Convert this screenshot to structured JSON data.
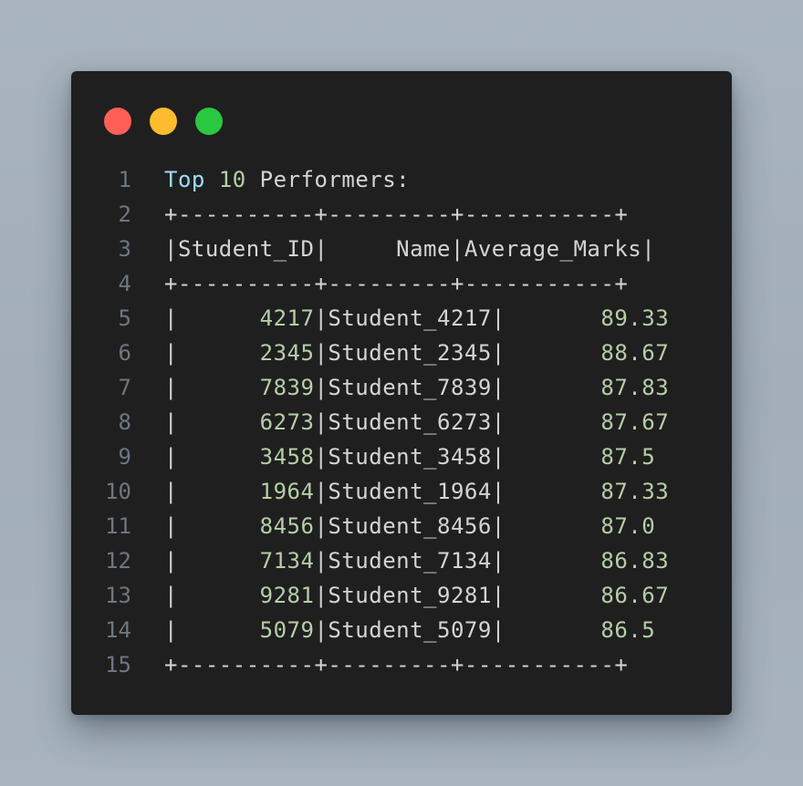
{
  "window_controls": {
    "close_color": "#ff5f57",
    "minimize_color": "#febc2e",
    "maximize_color": "#28c840"
  },
  "theme": {
    "background": "#1f1f1f",
    "text": "#d4d4d4",
    "line_number": "#6e7681",
    "keyword": "#9cdcfe",
    "number": "#b5cea8"
  },
  "lines": [
    {
      "n": "1",
      "segments": [
        {
          "t": "Top",
          "c": "kw"
        },
        {
          "t": " ",
          "c": "plain"
        },
        {
          "t": "10",
          "c": "num"
        },
        {
          "t": " Performers:",
          "c": "plain"
        }
      ]
    },
    {
      "n": "2",
      "segments": [
        {
          "t": "+----------+---------+-----------+",
          "c": "plain"
        }
      ]
    },
    {
      "n": "3",
      "segments": [
        {
          "t": "|Student_ID|     Name|Average_Marks|",
          "c": "plain"
        }
      ]
    },
    {
      "n": "4",
      "segments": [
        {
          "t": "+----------+---------+-----------+",
          "c": "plain"
        }
      ]
    },
    {
      "n": "5",
      "segments": [
        {
          "t": "|      ",
          "c": "plain"
        },
        {
          "t": "4217",
          "c": "num"
        },
        {
          "t": "|Student_4217|       ",
          "c": "plain"
        },
        {
          "t": "89.33",
          "c": "num"
        }
      ]
    },
    {
      "n": "6",
      "segments": [
        {
          "t": "|      ",
          "c": "plain"
        },
        {
          "t": "2345",
          "c": "num"
        },
        {
          "t": "|Student_2345|       ",
          "c": "plain"
        },
        {
          "t": "88.67",
          "c": "num"
        }
      ]
    },
    {
      "n": "7",
      "segments": [
        {
          "t": "|      ",
          "c": "plain"
        },
        {
          "t": "7839",
          "c": "num"
        },
        {
          "t": "|Student_7839|       ",
          "c": "plain"
        },
        {
          "t": "87.83",
          "c": "num"
        }
      ]
    },
    {
      "n": "8",
      "segments": [
        {
          "t": "|      ",
          "c": "plain"
        },
        {
          "t": "6273",
          "c": "num"
        },
        {
          "t": "|Student_6273|       ",
          "c": "plain"
        },
        {
          "t": "87.67",
          "c": "num"
        }
      ]
    },
    {
      "n": "9",
      "segments": [
        {
          "t": "|      ",
          "c": "plain"
        },
        {
          "t": "3458",
          "c": "num"
        },
        {
          "t": "|Student_3458|       ",
          "c": "plain"
        },
        {
          "t": "87.5",
          "c": "num"
        }
      ]
    },
    {
      "n": "10",
      "segments": [
        {
          "t": "|      ",
          "c": "plain"
        },
        {
          "t": "1964",
          "c": "num"
        },
        {
          "t": "|Student_1964|       ",
          "c": "plain"
        },
        {
          "t": "87.33",
          "c": "num"
        }
      ]
    },
    {
      "n": "11",
      "segments": [
        {
          "t": "|      ",
          "c": "plain"
        },
        {
          "t": "8456",
          "c": "num"
        },
        {
          "t": "|Student_8456|       ",
          "c": "plain"
        },
        {
          "t": "87.0",
          "c": "num"
        }
      ]
    },
    {
      "n": "12",
      "segments": [
        {
          "t": "|      ",
          "c": "plain"
        },
        {
          "t": "7134",
          "c": "num"
        },
        {
          "t": "|Student_7134|       ",
          "c": "plain"
        },
        {
          "t": "86.83",
          "c": "num"
        }
      ]
    },
    {
      "n": "13",
      "segments": [
        {
          "t": "|      ",
          "c": "plain"
        },
        {
          "t": "9281",
          "c": "num"
        },
        {
          "t": "|Student_9281|       ",
          "c": "plain"
        },
        {
          "t": "86.67",
          "c": "num"
        }
      ]
    },
    {
      "n": "14",
      "segments": [
        {
          "t": "|      ",
          "c": "plain"
        },
        {
          "t": "5079",
          "c": "num"
        },
        {
          "t": "|Student_5079|       ",
          "c": "plain"
        },
        {
          "t": "86.5",
          "c": "num"
        }
      ]
    },
    {
      "n": "15",
      "segments": [
        {
          "t": "+----------+---------+-----------+",
          "c": "plain"
        }
      ]
    }
  ]
}
